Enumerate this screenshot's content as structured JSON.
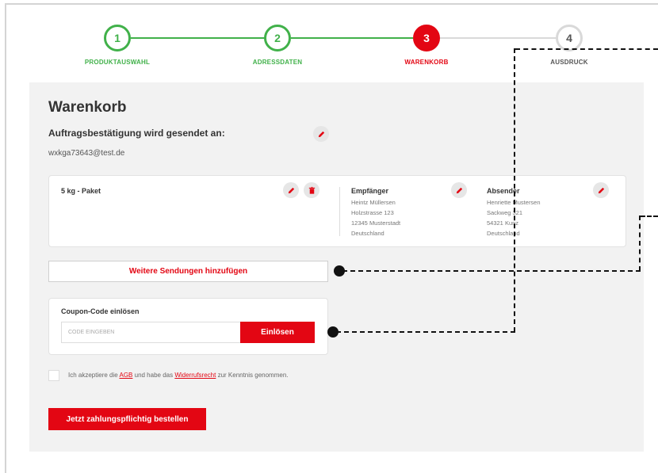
{
  "stepper": {
    "steps": [
      {
        "number": "1",
        "label": "PRODUKTAUSWAHL",
        "state": "done"
      },
      {
        "number": "2",
        "label": "ADRESSDATEN",
        "state": "done"
      },
      {
        "number": "3",
        "label": "WARENKORB",
        "state": "active"
      },
      {
        "number": "4",
        "label": "AUSDRUCK",
        "state": "todo"
      }
    ],
    "colors": {
      "done": "#41b14a",
      "active": "#e30613",
      "todo": "#d9d9d9"
    }
  },
  "cart": {
    "title": "Warenkorb",
    "confirmation_label": "Auftragsbestätigung wird gesendet an:",
    "email": "wxkga73643@test.de"
  },
  "shipment": {
    "package": "5 kg - Paket",
    "recipient": {
      "heading": "Empfänger",
      "lines": [
        "Heintz Müllersen",
        "Holzstrasse 123",
        "12345 Musterstadt",
        "Deutschland"
      ]
    },
    "sender": {
      "heading": "Absender",
      "lines": [
        "Henriette Mustersen",
        "Sackweg 321",
        "54321 Kunz",
        "Deutschland"
      ]
    }
  },
  "actions": {
    "add_shipment": "Weitere Sendungen hinzufügen",
    "coupon_title": "Coupon-Code einlösen",
    "coupon_placeholder": "CODE EINGEBEN",
    "coupon_button": "Einlösen",
    "order_button": "Jetzt zahlungspflichtig bestellen"
  },
  "terms": {
    "prefix": "Ich akzeptiere die ",
    "agb": "AGB",
    "middle": " und habe das ",
    "widerruf": "Widerrufsrecht",
    "suffix": " zur Kenntnis genommen."
  },
  "icons": {
    "edit": "pencil-icon",
    "delete": "trash-icon"
  },
  "accent_color": "#e30613"
}
